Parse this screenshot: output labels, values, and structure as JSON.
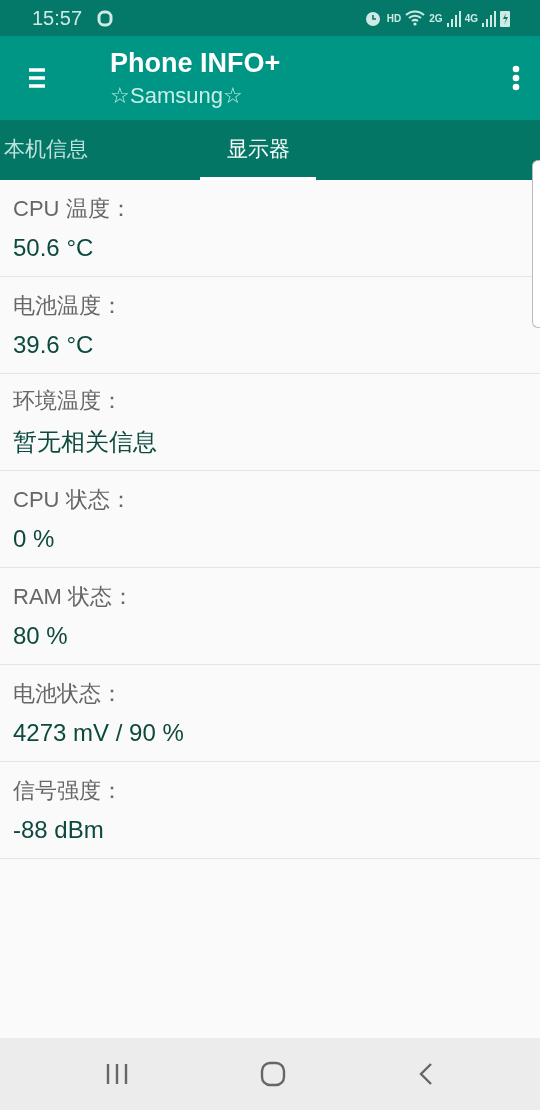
{
  "status_bar": {
    "time": "15:57",
    "hd": "HD",
    "sim_1": "2G",
    "sim_2": "4G"
  },
  "app_bar": {
    "title": "Phone INFO+",
    "subtitle": "☆Samsung☆"
  },
  "tabs": [
    {
      "label": "本机信息",
      "selected": false
    },
    {
      "label": "显示器",
      "selected": true
    }
  ],
  "items": [
    {
      "label": "CPU 温度：",
      "value": "50.6 °C"
    },
    {
      "label": "电池温度：",
      "value": "39.6 °C"
    },
    {
      "label": "环境温度：",
      "value": "暂无相关信息"
    },
    {
      "label": "CPU 状态：",
      "value": "0 %"
    },
    {
      "label": "RAM 状态：",
      "value": "80 %"
    },
    {
      "label": "电池状态：",
      "value": "4273 mV / 90 %"
    },
    {
      "label": "信号强度：",
      "value": "-88 dBm"
    }
  ]
}
